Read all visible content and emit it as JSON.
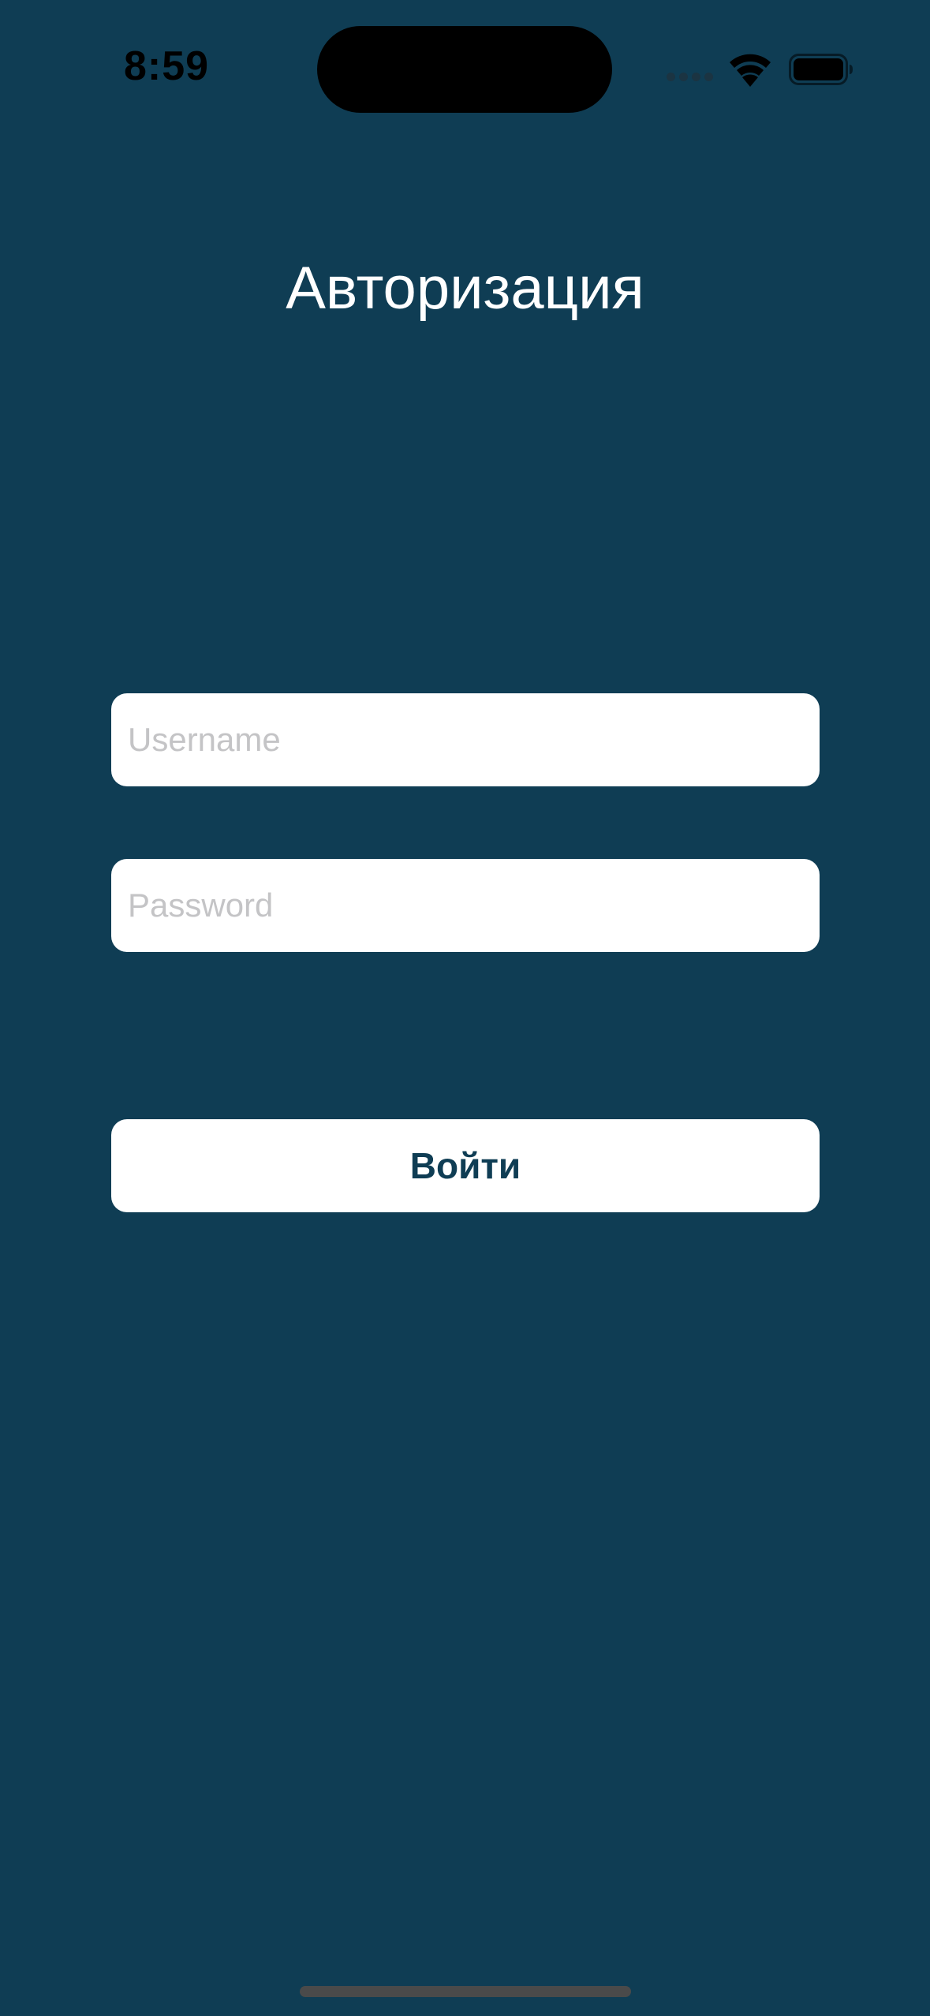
{
  "status_bar": {
    "time": "8:59",
    "icons": [
      "signal-icon",
      "wifi-icon",
      "battery-icon"
    ]
  },
  "screen": {
    "title": "Авторизация",
    "background_color": "#0F3D54"
  },
  "form": {
    "username": {
      "value": "",
      "placeholder": "Username"
    },
    "password": {
      "value": "",
      "placeholder": "Password"
    },
    "login_label": "Войти"
  },
  "colors": {
    "background": "#0F3D54",
    "field_background": "#FFFFFF",
    "placeholder": "#C4C4C6",
    "button_text": "#0F3D54"
  }
}
